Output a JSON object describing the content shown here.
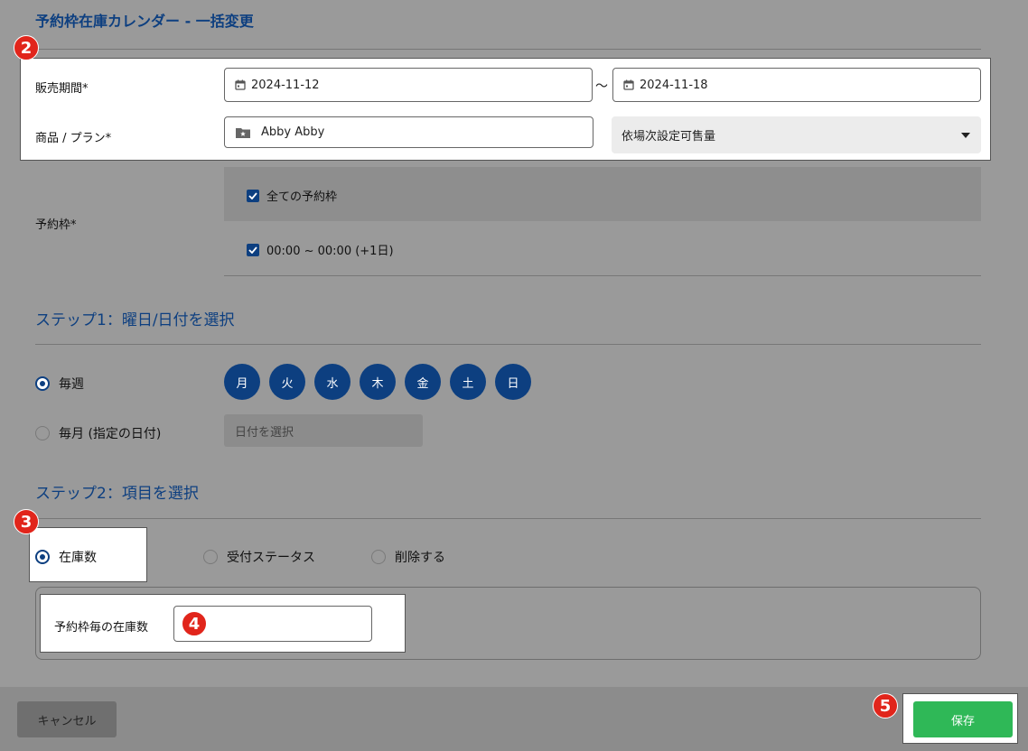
{
  "page": {
    "title": "予約枠在庫カレンダー - 一括変更"
  },
  "sales_period": {
    "label": "販売期間*",
    "start": "2024-11-12",
    "separator": "〜",
    "end": "2024-11-18"
  },
  "product": {
    "label": "商品 / プラン*",
    "value": "Abby Abby",
    "mode_select": "依場次設定可售量"
  },
  "slots": {
    "label": "予約枠*",
    "all_label": "全ての予約枠",
    "slot_label": "00:00 ~ 00:00 (+1日)"
  },
  "step1": {
    "title": "ステップ1：曜日/日付を選択",
    "weekly_label": "毎週",
    "monthly_label": "毎月 (指定の日付)",
    "date_placeholder": "日付を選択",
    "days": [
      "月",
      "火",
      "水",
      "木",
      "金",
      "土",
      "日"
    ]
  },
  "step2": {
    "title": "ステップ2：項目を選択",
    "options": [
      "在庫数",
      "受付ステータス",
      "削除する"
    ],
    "stock_label": "予約枠毎の在庫数",
    "stock_value": ""
  },
  "footer": {
    "cancel_label": "キャンセル",
    "save_label": "保存"
  },
  "badges": [
    "2",
    "3",
    "4",
    "5"
  ],
  "colors": {
    "accent": "#0d3f80",
    "save": "#2fb857",
    "badge": "#e1251b"
  }
}
